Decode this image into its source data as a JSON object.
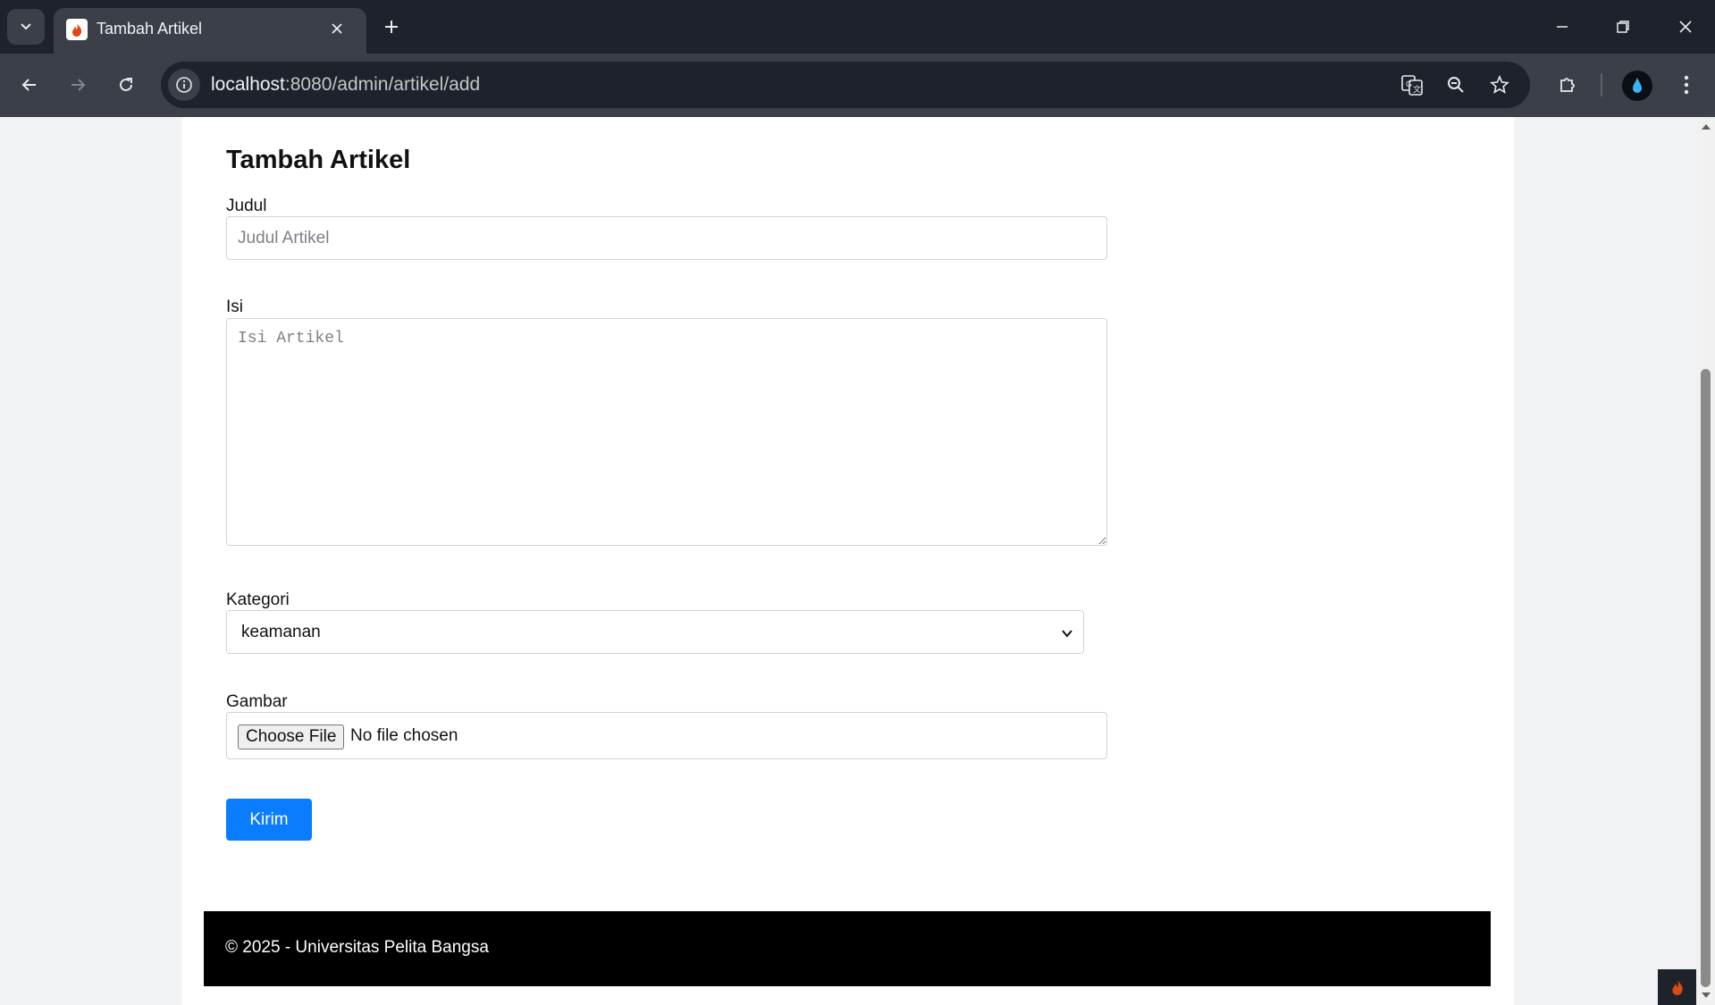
{
  "browser": {
    "tab_title": "Tambah Artikel",
    "url_host": "localhost",
    "url_path": ":8080/admin/artikel/add"
  },
  "page": {
    "title": "Tambah Artikel",
    "judul_label": "Judul",
    "judul_placeholder": "Judul Artikel",
    "judul_value": "",
    "isi_label": "Isi",
    "isi_placeholder": "Isi Artikel",
    "isi_value": "",
    "kategori_label": "Kategori",
    "kategori_selected": "keamanan",
    "gambar_label": "Gambar",
    "file_button": "Choose File",
    "file_status": "No file chosen",
    "submit_label": "Kirim"
  },
  "footer": {
    "text": "© 2025 - Universitas Pelita Bangsa"
  },
  "colors": {
    "accent": "#0a7cff",
    "footer_bg": "#000000",
    "chrome_dark": "#1e222a",
    "chrome_toolbar": "#3a3f48"
  }
}
